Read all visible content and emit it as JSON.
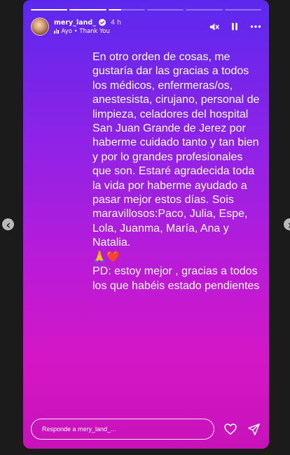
{
  "header": {
    "username": "mery_land_",
    "time": "4 h",
    "audio_line": "Ayo • Thank You"
  },
  "progress": [
    1,
    1,
    0.35,
    0,
    0,
    0
  ],
  "story_text": [
    "En otro orden de cosas, me gustaría dar las gracias a todos los médicos, enfermeras/os, anestesista, cirujano, personal de limpieza, celadores del hospital San Juan Grande de Jerez por haberme cuidado tanto y tan bien y por lo grandes profesionales que son. Estaré agradecida toda la vida por haberme ayudado a pasar mejor estos días. Sois maravillosos:Paco, Julia, Espe, Lola, Juanma, María, Ana y Natalia.",
    "🙏❤️",
    "PD: estoy mejor , gracias a todos los que habéis estado pendientes"
  ],
  "footer": {
    "reply_placeholder": "Responde a mery_land_..."
  },
  "icons": {
    "mute": "speaker-muted-icon",
    "pause": "pause-icon",
    "more": "more-options-icon",
    "like": "heart-icon",
    "share": "send-icon"
  }
}
